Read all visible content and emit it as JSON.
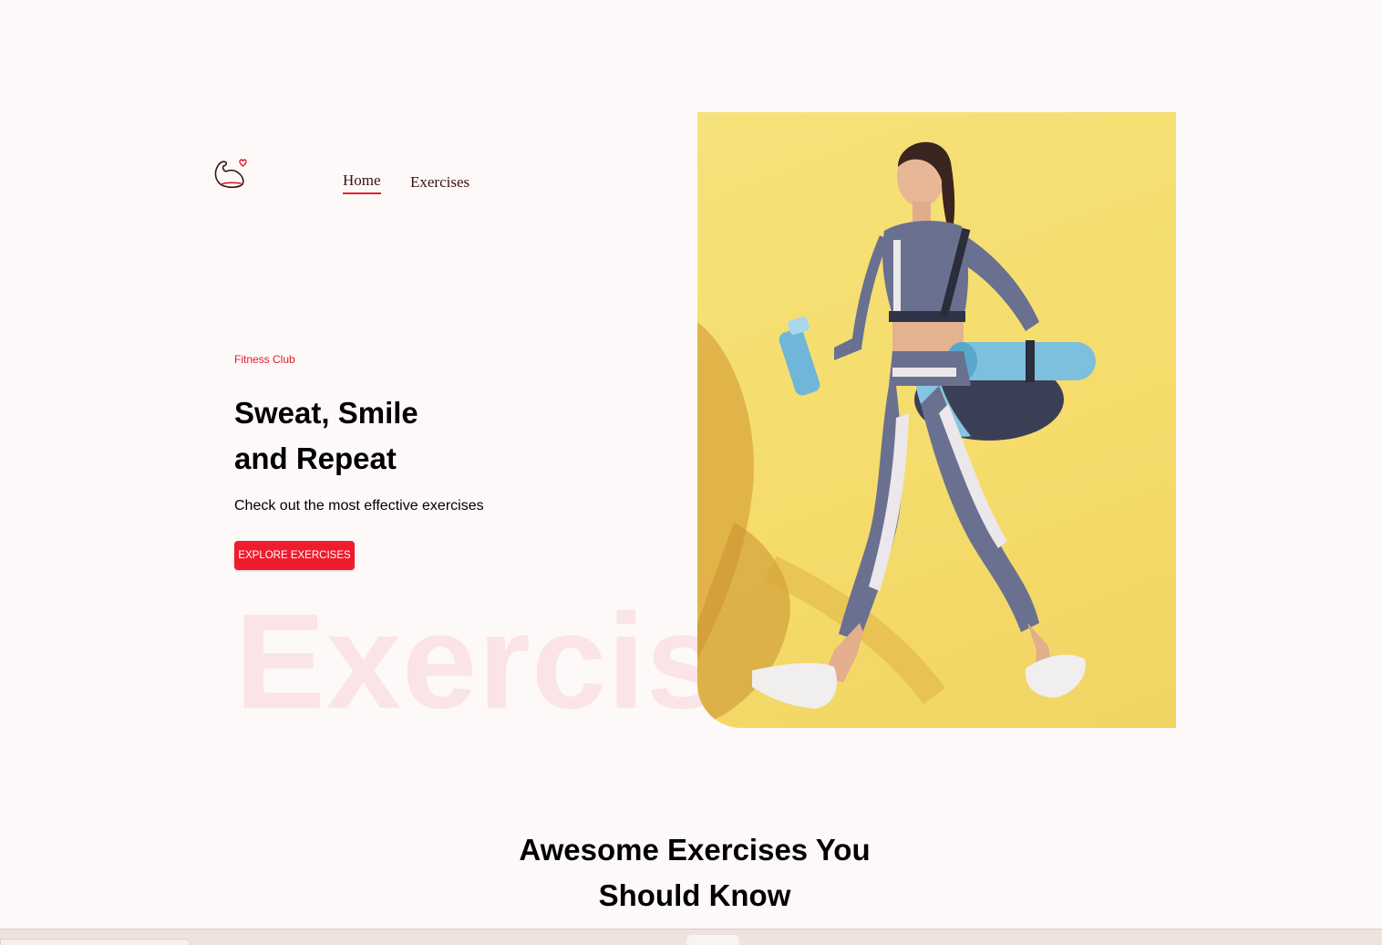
{
  "nav": {
    "logo_icon": "flexed-arm-heart-icon",
    "home_label": "Home",
    "exercises_label": "Exercises",
    "accent_color": "#ef1c2e"
  },
  "hero": {
    "kicker": "Fitness Club",
    "headline_line1": "Sweat, Smile",
    "headline_line2": "and Repeat",
    "subtext": "Check out the most effective exercises",
    "cta_label": "EXPLORE EXERCISES",
    "watermark": "Exercis",
    "image_alt": "woman-walking-with-gym-bag-and-shaker"
  },
  "section": {
    "title_line1": "Awesome Exercises You",
    "title_line2": "Should Know"
  }
}
